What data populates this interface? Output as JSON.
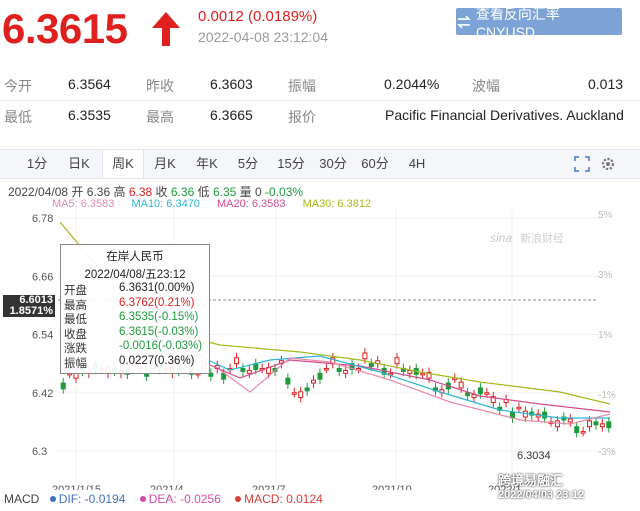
{
  "header": {
    "price": "6.3615",
    "change": "0.0012 (0.0189%)",
    "timestamp": "2022-04-08 23:12:04",
    "reverse_button": "查看反向汇率 CNYUSD",
    "up_color": "#e0201f"
  },
  "quote": {
    "row1": [
      {
        "label": "今开",
        "value": "6.3564"
      },
      {
        "label": "昨收",
        "value": "6.3603"
      },
      {
        "label": "振幅",
        "value": "0.2044%"
      },
      {
        "label": "波幅",
        "value": "0.013"
      }
    ],
    "row2": [
      {
        "label": "最低",
        "value": "6.3535"
      },
      {
        "label": "最高",
        "value": "6.3665"
      },
      {
        "label": "报价",
        "value": "Pacific Financial Derivatives. Auckland"
      }
    ]
  },
  "tabs": [
    "1分",
    "日K",
    "周K",
    "月K",
    "年K",
    "5分",
    "15分",
    "30分",
    "60分",
    "4H"
  ],
  "active_tab": "周K",
  "ohlc": {
    "date": "2022/04/08",
    "open_label": "开",
    "open": "6.36",
    "high_label": "高",
    "high": "6.38",
    "close_label": "收",
    "close": "6.36",
    "low_label": "低",
    "low": "6.35",
    "vol_label": "量",
    "vol": "0",
    "pct": "-0.03%"
  },
  "ma": [
    {
      "label": "MA5: 6.3583",
      "color": "#e88aa6"
    },
    {
      "label": "MA10: 6.3470",
      "color": "#2bb6d8"
    },
    {
      "label": "MA20: 6.3583",
      "color": "#d64a8c"
    },
    {
      "label": "MA30: 6.3812",
      "color": "#a7b81a"
    }
  ],
  "axis": {
    "left_ticks": [
      "6.78",
      "6.66",
      "6.54",
      "6.42",
      "6.3"
    ],
    "right_ticks": [
      "5%",
      "3%",
      "1%",
      "-1%",
      "-3%"
    ],
    "x_ticks": [
      "2021/1/15",
      "2021/4",
      "2021/7",
      "2021/10",
      "2022/1"
    ],
    "cursor_price": "6.6013",
    "cursor_pct": "1.8571%",
    "low_annotation": "6.3034",
    "brand_mark": "新浪财经",
    "brand_url": "sina"
  },
  "tooltip": {
    "title": "在岸人民币",
    "date": "2022/04/08/五23:12",
    "rows": [
      {
        "label": "开盘",
        "value": "6.3631(0.00%)",
        "color": "#222222"
      },
      {
        "label": "最高",
        "value": "6.3762(0.21%)",
        "color": "#e0201f"
      },
      {
        "label": "最低",
        "value": "6.3535(-0.15%)",
        "color": "#1d9b3c"
      },
      {
        "label": "收盘",
        "value": "6.3615(-0.03%)",
        "color": "#1d9b3c"
      },
      {
        "label": "涨跌",
        "value": "-0.0016(-0.03%)",
        "color": "#1d9b3c"
      },
      {
        "label": "振幅",
        "value": "0.0227(0.36%)",
        "color": "#222222"
      }
    ]
  },
  "macd": {
    "label": "MACD",
    "dif": "DIF: -0.0194",
    "dea": "DEA: -0.0256",
    "macd": "MACD: 0.0124"
  },
  "watermark": "跨境易融汇",
  "watermark_ts": "2022/04/03 23:12"
}
